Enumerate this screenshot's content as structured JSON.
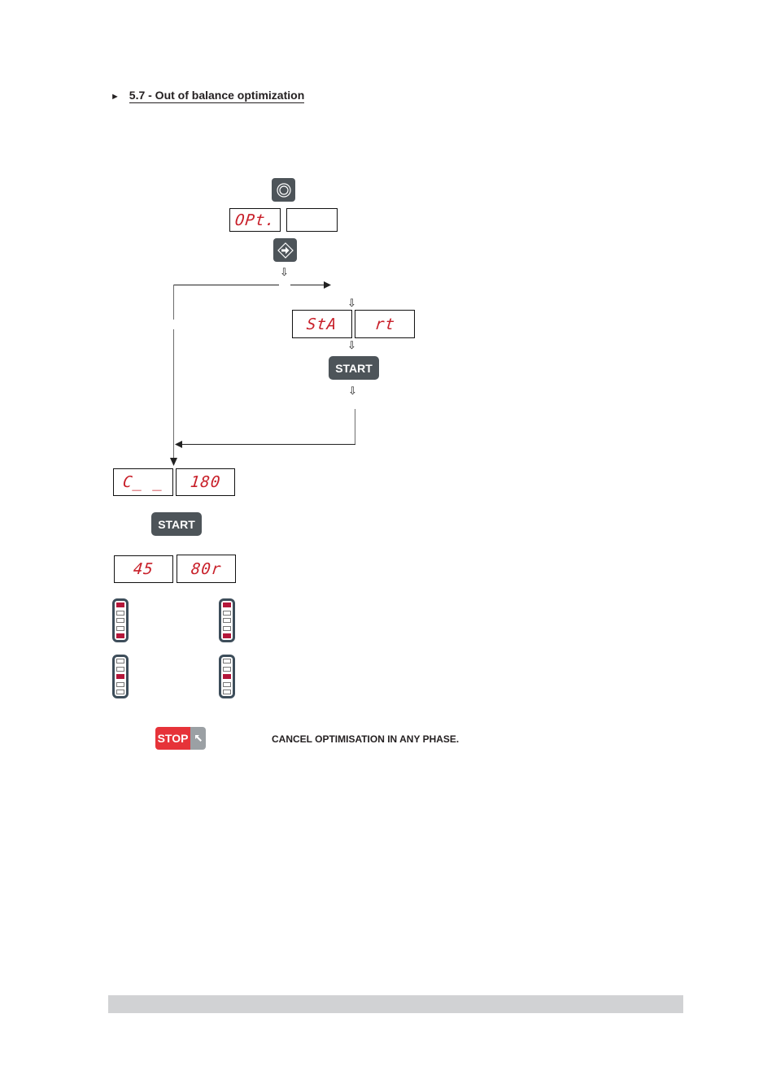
{
  "heading": {
    "marker": "►",
    "title": "5.7 - Out of balance optimization"
  },
  "icons": {
    "rotate": "rotate-circle-icon",
    "enter": "enter-arrow-icon",
    "stop_corner": "arrow-up-left-icon",
    "down_arrow": "⇩"
  },
  "flow": {
    "step1_display": {
      "left": "OPt.",
      "right": ""
    },
    "step2_display": {
      "left": "StA",
      "right": "rt"
    },
    "start_label": "START",
    "step3_display": {
      "left": "C_ _",
      "right": "180"
    },
    "step4_display": {
      "left": "45",
      "right": "80r"
    },
    "led_indicators": [
      {
        "position": "top-left",
        "lit": [
          0,
          4
        ]
      },
      {
        "position": "top-right",
        "lit": [
          0,
          4
        ]
      },
      {
        "position": "bottom-left",
        "lit": [
          2
        ]
      },
      {
        "position": "bottom-right",
        "lit": [
          2
        ]
      }
    ]
  },
  "stop": {
    "label": "STOP",
    "description": "CANCEL OPTIMISATION IN ANY PHASE."
  },
  "colors": {
    "segment_red": "#c8202a",
    "button_grey": "#4d5459",
    "stop_red": "#e63339",
    "led_on": "#b4173a",
    "footer_bar": "#d1d2d4"
  }
}
